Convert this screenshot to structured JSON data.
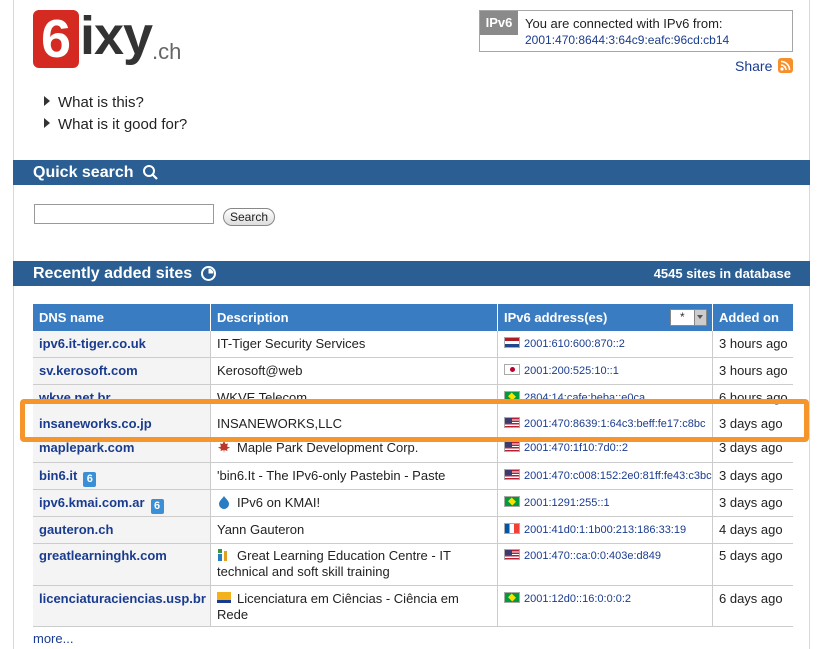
{
  "logo": {
    "six": "6",
    "ixy": "ixy",
    "ch": ".ch"
  },
  "connection": {
    "tag": "IPv6",
    "message": "You are connected with IPv6 from:",
    "address": "2001:470:8644:3:64c9:eafc:96cd:cb14"
  },
  "share_label": "Share",
  "info_links": [
    {
      "label": "What is this?"
    },
    {
      "label": "What is it good for?"
    }
  ],
  "quick_search": {
    "title": "Quick search",
    "input_value": "",
    "button_label": "Search"
  },
  "recent": {
    "title": "Recently added sites",
    "count_text": "4545 sites in database"
  },
  "table": {
    "headers": {
      "dns": "DNS name",
      "description": "Description",
      "ipv6": "IPv6 address(es)",
      "added": "Added on"
    },
    "filter_value": "*",
    "rows": [
      {
        "dns": "ipv6.it-tiger.co.uk",
        "description": "IT-Tiger Security Services",
        "ipv6": "2001:610:600:870::2",
        "added": "3 hours ago",
        "flag": "nl"
      },
      {
        "dns": "sv.kerosoft.com",
        "description": "Kerosoft@web",
        "ipv6": "2001:200:525:10::1",
        "added": "3 hours ago",
        "flag": "jp"
      },
      {
        "dns": "wkve.net.br",
        "description": "WKVE Telecom",
        "ipv6": "2804:14:cafe:beba::e0ca",
        "added": "6 hours ago",
        "flag": "br"
      },
      {
        "dns": "insaneworks.co.jp",
        "description": "INSANEWORKS,LLC",
        "ipv6": "2001:470:8639:1:64c3:beff:fe17:c8bc",
        "added": "3 days ago",
        "flag": "us"
      },
      {
        "dns": "maplepark.com",
        "description": "Maple Park Development Corp.",
        "ipv6": "2001:470:1f10:7d0::2",
        "added": "3 days ago",
        "flag": "us"
      },
      {
        "dns": "bin6.it",
        "description": "'bin6.It - The IPv6-only Pastebin - Paste",
        "ipv6": "2001:470:c008:152:2e0:81ff:fe43:c3bc",
        "added": "3 days ago",
        "flag": "us"
      },
      {
        "dns": "ipv6.kmai.com.ar",
        "description": "IPv6 on KMAI!",
        "ipv6": "2001:1291:255::1",
        "added": "3 days ago",
        "flag": "br"
      },
      {
        "dns": "gauteron.ch",
        "description": "Yann Gauteron",
        "ipv6": "2001:41d0:1:1b00:213:186:33:19",
        "added": "4 days ago",
        "flag": "fr"
      },
      {
        "dns": "greatlearninghk.com",
        "description_line1": "Great Learning Education Centre - IT",
        "description_line2": "technical and soft skill training",
        "ipv6": "2001:470::ca:0:0:403e:d849",
        "added": "5 days ago",
        "flag": "us"
      },
      {
        "dns": "licenciaturaciencias.usp.br",
        "description_line1": "Licenciatura em Ciências - Ciência em",
        "description_line2": "Rede",
        "ipv6": "2001:12d0::16:0:0:0:2",
        "added": "6 days ago",
        "flag": "br"
      }
    ]
  },
  "more_label": "more...",
  "colors": {
    "bar": "#2b5f93",
    "table_header": "#3a7cc1",
    "highlight": "#f6952c",
    "logo_red": "#d42a21"
  }
}
